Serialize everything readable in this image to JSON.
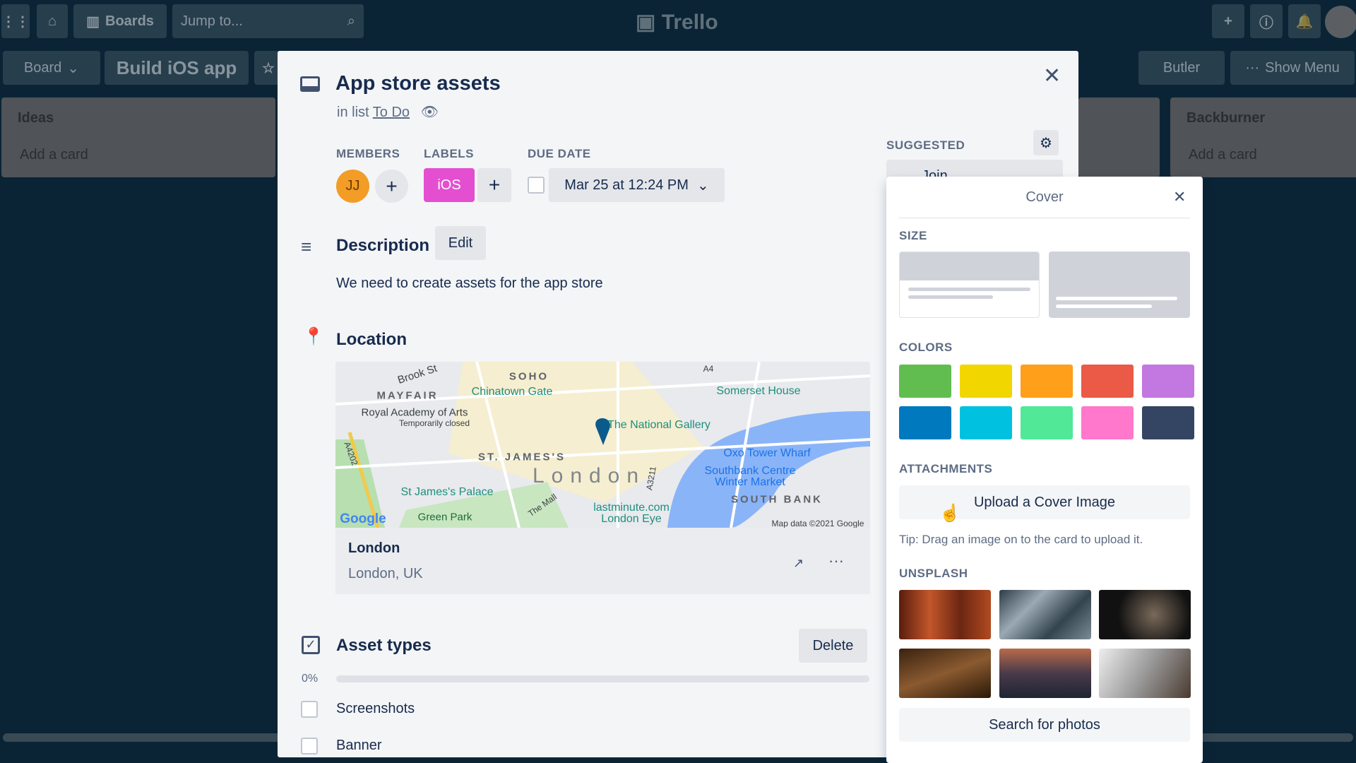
{
  "topbar": {
    "boards": "Boards",
    "search_placeholder": "Jump to...",
    "logo": "Trello"
  },
  "boardbar": {
    "view": "Board",
    "board_name": "Build iOS app",
    "butler": "Butler",
    "show_menu": "Show Menu"
  },
  "lists": [
    {
      "title": "Ideas",
      "add": "Add a card"
    },
    {
      "title": "Backburner",
      "add": "Add a card"
    }
  ],
  "card": {
    "title": "App store assets",
    "in_list_prefix": "in list",
    "list_name": "To Do",
    "members_label": "MEMBERS",
    "member_initials": "JJ",
    "labels_label": "LABELS",
    "label": "iOS",
    "label_color": "#e44fd1",
    "due_label": "DUE DATE",
    "due_date": "Mar 25 at 12:24 PM",
    "description_title": "Description",
    "edit": "Edit",
    "description": "We need to create assets for the app store",
    "location_title": "Location",
    "location_name": "London",
    "location_sub": "London, UK",
    "map": {
      "labels": [
        "Brook St",
        "SOHO",
        "MAYFAIR",
        "Chinatown Gate",
        "Royal Academy of Arts",
        "Temporarily closed",
        "Somerset House",
        "The National Gallery",
        "ST. JAMES'S",
        "London",
        "Oxo Tower Wharf",
        "Southbank Centre",
        "Winter Market",
        "SOUTH BANK",
        "St James's Palace",
        "Green Park",
        "The Mall",
        "lastminute.com",
        "London Eye",
        "A4202",
        "A3211",
        "A4"
      ],
      "google": "Google",
      "attribution": "Map data ©2021 Google"
    },
    "checklist_title": "Asset types",
    "delete": "Delete",
    "progress": "0%",
    "progress_value": 0,
    "items": [
      {
        "text": "Screenshots",
        "checked": false
      },
      {
        "text": "Banner",
        "checked": false
      }
    ],
    "suggested": "SUGGESTED",
    "join": "Join"
  },
  "cover": {
    "title": "Cover",
    "size": "SIZE",
    "colors_label": "COLORS",
    "colors": [
      "#61bd4f",
      "#f2d600",
      "#ff9f1a",
      "#eb5a46",
      "#c377e0",
      "#0079bf",
      "#00c2e0",
      "#51e898",
      "#ff78cb",
      "#344563"
    ],
    "attachments": "ATTACHMENTS",
    "upload": "Upload a Cover Image",
    "tip": "Tip: Drag an image on to the card to upload it.",
    "unsplash": "UNSPLASH",
    "search": "Search for photos"
  }
}
